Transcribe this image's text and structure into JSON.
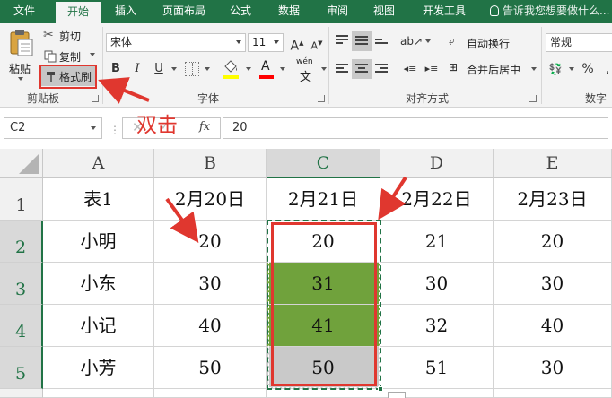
{
  "ribbon_tabs": [
    "文件",
    "开始",
    "插入",
    "页面布局",
    "公式",
    "数据",
    "审阅",
    "视图",
    "开发工具"
  ],
  "active_tab": "开始",
  "tell_me": "告诉我您想要做什么...",
  "clipboard": {
    "paste": "粘贴",
    "cut": "剪切",
    "copy": "复制",
    "format_painter": "格式刷",
    "group_label": "剪贴板"
  },
  "font": {
    "name": "宋体",
    "size": "11",
    "grow": "A",
    "shrink": "A",
    "bold": "B",
    "italic": "I",
    "underline": "U",
    "font_color_glyph": "A",
    "phonetic_top": "wén",
    "phonetic_bottom": "文",
    "group_label": "字体"
  },
  "alignment": {
    "wrap_text": "自动换行",
    "merge_center": "合并后居中",
    "group_label": "对齐方式"
  },
  "number": {
    "format": "常规",
    "percent": "%",
    "group_label": "数字"
  },
  "formula_bar": {
    "name_box": "C2",
    "fx": "fx",
    "cancel": "✕",
    "enter": "✓",
    "content": "20"
  },
  "annotation": {
    "caption": "双击",
    "annotation_color": "#e0372f"
  },
  "columns": [
    "A",
    "B",
    "C",
    "D",
    "E"
  ],
  "rows": [
    "1",
    "2",
    "3",
    "4",
    "5"
  ],
  "cells": [
    [
      "表1",
      "2月20日",
      "2月21日",
      "2月22日",
      "2月23日"
    ],
    [
      "小明",
      "20",
      "20",
      "21",
      "20"
    ],
    [
      "小东",
      "30",
      "31",
      "30",
      "30"
    ],
    [
      "小记",
      "40",
      "41",
      "32",
      "40"
    ],
    [
      "小芳",
      "50",
      "50",
      "51",
      "30"
    ]
  ],
  "cell_fill": {
    "C3": "#70a23c",
    "C4": "#70a23c",
    "C5": "#c9c9c9"
  },
  "theme": {
    "excel_green": "#217346",
    "selected_header_bg": "#d9d9d9"
  }
}
